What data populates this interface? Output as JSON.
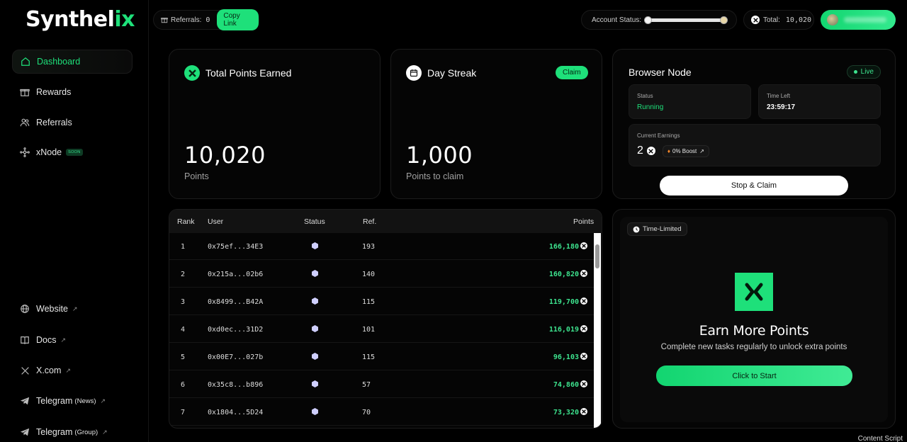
{
  "brand": {
    "name_main": "Synthel",
    "name_accent": "ix"
  },
  "sidebar": {
    "items": [
      {
        "label": "Dashboard",
        "icon": "home-icon",
        "active": true
      },
      {
        "label": "Rewards",
        "icon": "gift-icon"
      },
      {
        "label": "Referrals",
        "icon": "users-icon"
      },
      {
        "label": "xNode",
        "icon": "node-icon",
        "badge": "SOON"
      }
    ],
    "links": [
      {
        "label": "Website",
        "icon": "globe-icon"
      },
      {
        "label": "Docs",
        "icon": "book-icon"
      },
      {
        "label": "X.com",
        "icon": "x-logo-icon"
      },
      {
        "label": "Telegram",
        "suffix": "(News)",
        "icon": "telegram-icon"
      },
      {
        "label": "Telegram",
        "suffix": "(Group)",
        "icon": "telegram-icon"
      }
    ],
    "external_glyph": "↗"
  },
  "topbar": {
    "referrals_label": "Referrals:",
    "referrals_count": "0",
    "copy_link": "Copy Link",
    "account_status_label": "Account Status:",
    "total_label": "Total:",
    "total_value": "10,020"
  },
  "cards": {
    "total_points": {
      "title": "Total Points Earned",
      "value": "10,020",
      "sub": "Points"
    },
    "day_streak": {
      "title": "Day Streak",
      "claim": "Claim",
      "value": "1,000",
      "sub": "Points to claim"
    },
    "browser_node": {
      "title": "Browser Node",
      "live": "Live",
      "status_label": "Status",
      "status_value": "Running",
      "time_left_label": "Time Left",
      "time_left_value": "23:59:17",
      "earnings_label": "Current Earnings",
      "earnings_value": "2",
      "boost": "0% Boost",
      "stop_claim": "Stop & Claim"
    }
  },
  "leaderboard": {
    "headers": {
      "rank": "Rank",
      "user": "User",
      "status": "Status",
      "ref": "Ref.",
      "points": "Points"
    },
    "rows": [
      {
        "rank": "1",
        "user": "0x75ef...34E3",
        "ref": "193",
        "points": "166,180"
      },
      {
        "rank": "2",
        "user": "0x215a...02b6",
        "ref": "140",
        "points": "160,820"
      },
      {
        "rank": "3",
        "user": "0x8499...B42A",
        "ref": "115",
        "points": "119,700"
      },
      {
        "rank": "4",
        "user": "0xd0ec...31D2",
        "ref": "101",
        "points": "116,019"
      },
      {
        "rank": "5",
        "user": "0x00E7...027b",
        "ref": "115",
        "points": "96,103"
      },
      {
        "rank": "6",
        "user": "0x35c8...b896",
        "ref": "57",
        "points": "74,860"
      },
      {
        "rank": "7",
        "user": "0x1804...5D24",
        "ref": "70",
        "points": "73,320"
      }
    ]
  },
  "promo": {
    "badge": "Time-Limited",
    "title": "Earn More Points",
    "subtitle": "Complete new tasks regularly to unlock extra points",
    "button": "Click to Start"
  },
  "corner_text": "Content Script",
  "colors": {
    "accent": "#1ee07a",
    "background": "#000000",
    "card": "#050505"
  }
}
